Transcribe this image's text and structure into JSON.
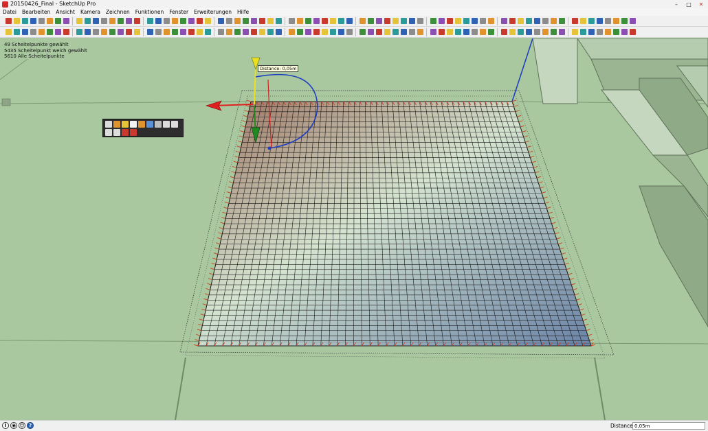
{
  "window": {
    "title": "20150426_Final - SketchUp Pro",
    "controls": [
      "–",
      "□",
      "✕"
    ]
  },
  "menu": [
    "Datei",
    "Bearbeiten",
    "Ansicht",
    "Kamera",
    "Zeichnen",
    "Funktionen",
    "Fenster",
    "Erweiterungen",
    "Hilfe"
  ],
  "toolbar_colors": {
    "orange": "#e0922c",
    "red": "#c93a2e",
    "blue": "#2f62b4",
    "green": "#3d8f3c",
    "yellow": "#e4c339",
    "gray": "#8c8c8c",
    "purple": "#8a4fb1",
    "teal": "#2d9a9a"
  },
  "viewport": {
    "selection_info": [
      "49 Scheitelpunkte gewählt",
      "5435 Scheitelpunkt weich gewählt",
      "5610 Alle Scheitelpunkte"
    ],
    "tooltip": "Distance: 0,05m",
    "background_color": "#a9c8a0"
  },
  "statusbar": {
    "icons": [
      "info-icon",
      "geo-location-icon",
      "credits-icon",
      "help-icon"
    ],
    "measurement_label": "Distance",
    "measurement_value": "0,05m"
  }
}
